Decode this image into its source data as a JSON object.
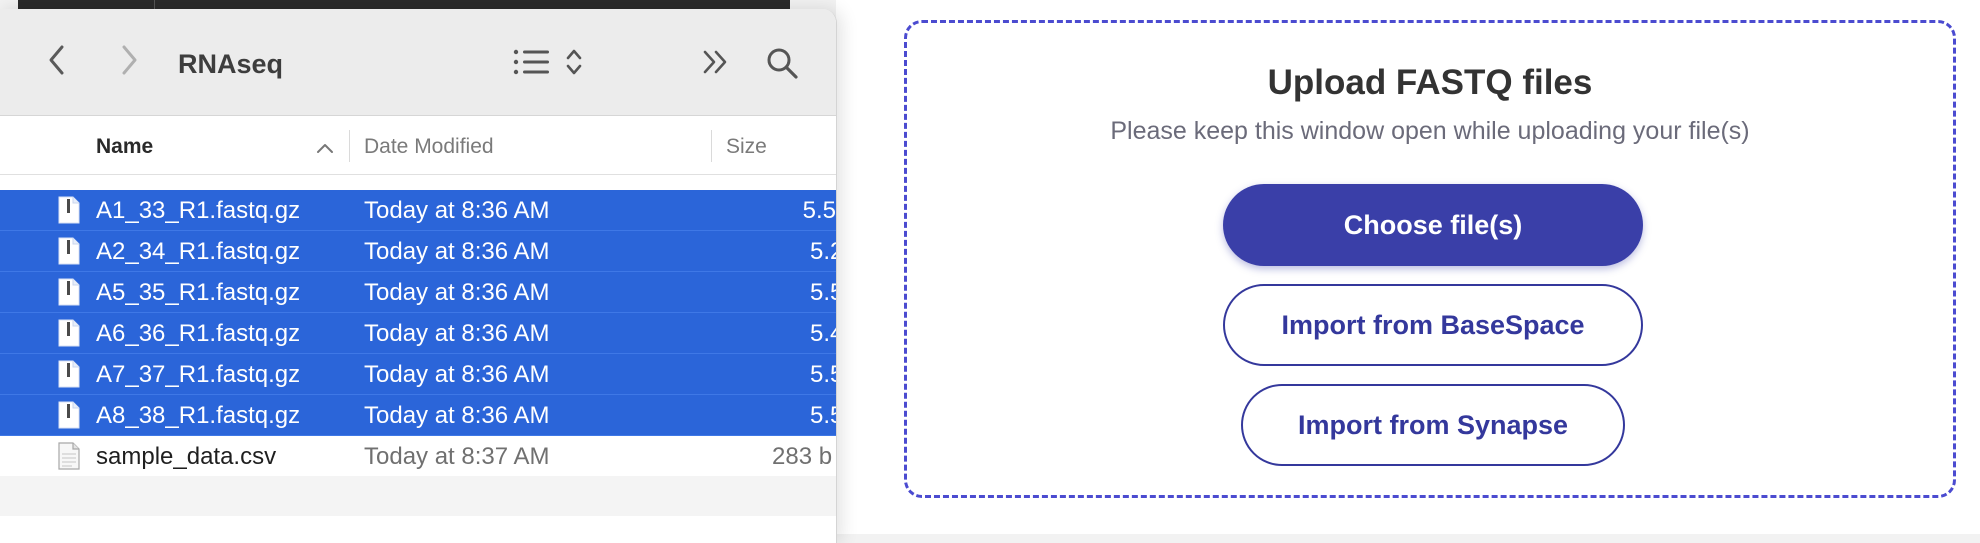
{
  "finder": {
    "title": "RNAseq",
    "icons": {
      "back": "chevron-left-icon",
      "forward": "chevron-right-icon",
      "view": "list-view-icon",
      "more": "double-chevron-icon",
      "search": "search-icon"
    },
    "columns": {
      "name": "Name",
      "date": "Date Modified",
      "size": "Size"
    },
    "rows": [
      {
        "name": "A1_33_R1.fastq.gz",
        "date": "Today at 8:36 AM",
        "size": "5.5",
        "selected": true
      },
      {
        "name": "A2_34_R1.fastq.gz",
        "date": "Today at 8:36 AM",
        "size": "5.2",
        "selected": true
      },
      {
        "name": "A5_35_R1.fastq.gz",
        "date": "Today at 8:36 AM",
        "size": "5.5",
        "selected": true
      },
      {
        "name": "A6_36_R1.fastq.gz",
        "date": "Today at 8:36 AM",
        "size": "5.4",
        "selected": true
      },
      {
        "name": "A7_37_R1.fastq.gz",
        "date": "Today at 8:36 AM",
        "size": "5.5",
        "selected": true
      },
      {
        "name": "A8_38_R1.fastq.gz",
        "date": "Today at 8:36 AM",
        "size": "5.5",
        "selected": true
      },
      {
        "name": "sample_data.csv",
        "date": "Today at 8:37 AM",
        "size": "283 b",
        "selected": false
      }
    ]
  },
  "upload": {
    "title": "Upload FASTQ files",
    "subtitle": "Please keep this window open while uploading your file(s)",
    "choose_label": "Choose file(s)",
    "basespace_label": "Import from BaseSpace",
    "synapse_label": "Import from Synapse"
  },
  "colors": {
    "selection": "#2b65d9",
    "accent": "#3a3fa8",
    "dashed_border": "#4b4bd0"
  }
}
